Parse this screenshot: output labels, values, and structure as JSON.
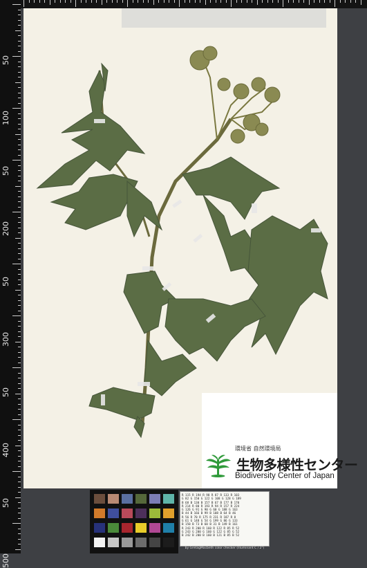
{
  "ruler": {
    "labels": [
      "50",
      "100",
      "50",
      "200",
      "50",
      "300",
      "50",
      "400",
      "50",
      "500"
    ]
  },
  "label": {
    "ministry": "環境省 自然環境局",
    "org_jp": "生物多様性センター",
    "org_en": "Biodiversity Center of Japan"
  },
  "colorchart": {
    "rows": [
      [
        "#6b4e3d",
        "#b88a74",
        "#5a6fa0",
        "#55683a",
        "#7c7db4",
        "#5fb4a8"
      ],
      [
        "#d17a2a",
        "#3f4f9e",
        "#b84a5a",
        "#4d2f5a",
        "#9cba3a",
        "#e0a02c"
      ],
      [
        "#27327a",
        "#4a8a3a",
        "#a8262e",
        "#e8cc2a",
        "#b04894",
        "#1f7fa8"
      ],
      [
        "#f2f2f2",
        "#c6c6c6",
        "#9a9a9a",
        "#6c6c6c",
        "#444444",
        "#1c1c1c"
      ]
    ],
    "table_text": "R 115 R 194 R 98 R 87 R 133 R 103\nG 82 G 150 G 122 G 108 G 128 G 189\nB 68 B 130 B 157 B 67 B 177 B 170\nR 214 R 80 R 193 R 94 R 157 R 224\nG 126 G 91 G 90 G 60 G 188 G 163\nB 44 B 166 B 99 B 108 B 64 B 46\nR 56 R 70 R 175 R 231 R 187 R 8\nG 61 G 148 G 54 G 199 G 86 G 133\nB 150 B 73 B 60 B 31 B 149 B 161\nR 243 R 200 R 160 R 122 R 85 R 52\nG 243 G 200 G 160 G 122 G 85 G 52\nB 242 B 200 B 160 B 121 B 85 B 52",
    "caption": "by GretagMacbeth color checker (Illuminant C / 2°)"
  }
}
